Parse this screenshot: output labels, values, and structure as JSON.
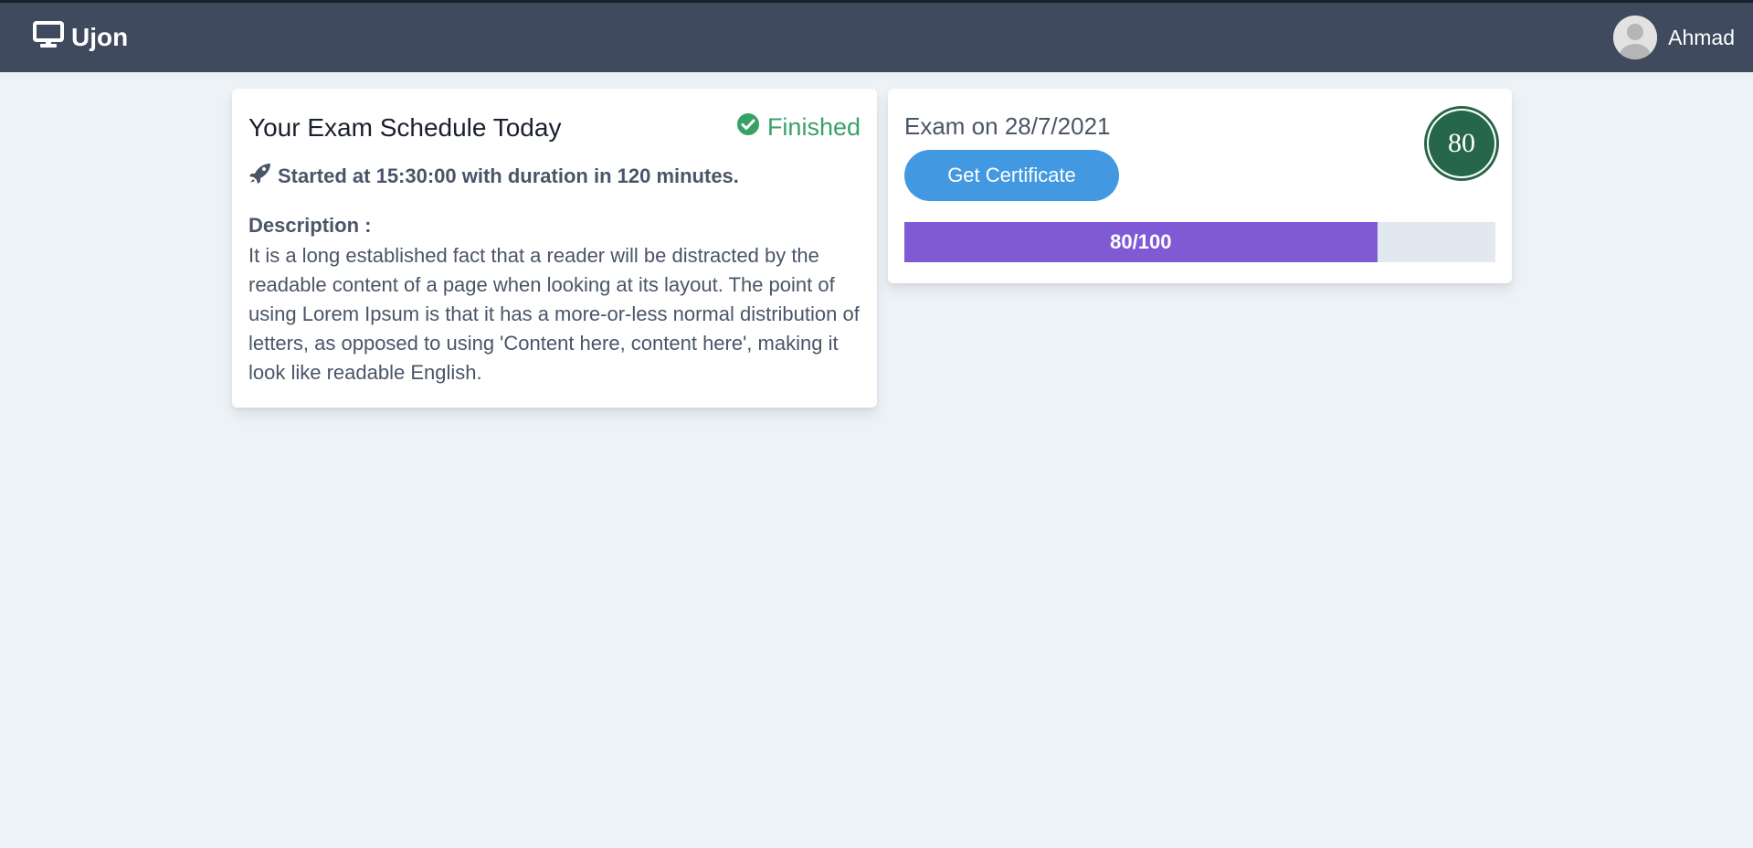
{
  "navbar": {
    "brand": "Ujon",
    "brand_icon": "desktop-icon",
    "user_name": "Ahmad",
    "avatar_icon": "user-avatar-icon"
  },
  "schedule_card": {
    "title": "Your Exam Schedule Today",
    "status": "Finished",
    "status_icon": "check-circle-icon",
    "status_color": "#38a169",
    "started_icon": "rocket-icon",
    "started_text": "Started at 15:30:00 with duration in 120 minutes.",
    "description_label": "Description :",
    "description": "It is a long established fact that a reader will be distracted by the readable content of a page when looking at its layout. The point of using Lorem Ipsum is that it has a more-or-less normal distribution of letters, as opposed to using 'Content here, content here', making it look like readable English."
  },
  "result_card": {
    "exam_date": "Exam on 28/7/2021",
    "certificate_button": "Get Certificate",
    "score": "80",
    "progress_label": "80/100",
    "progress_value": 80,
    "progress_max": 100,
    "progress_color": "#805ad5",
    "button_color": "#4299e1",
    "score_color": "#276749"
  }
}
